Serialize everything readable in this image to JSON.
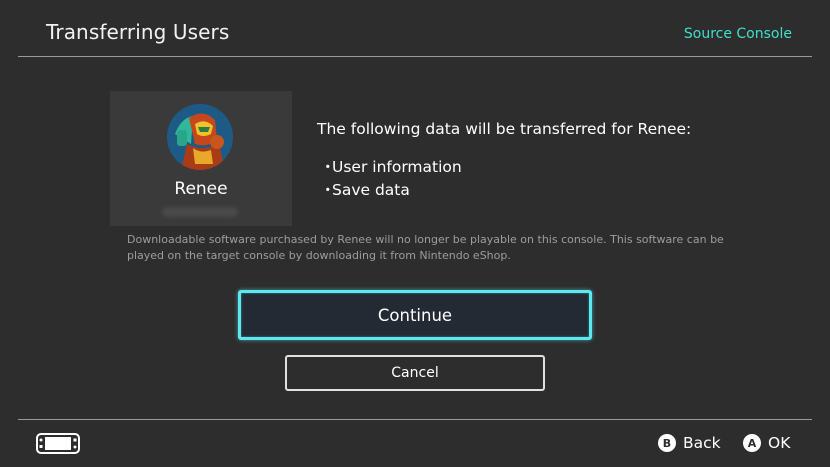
{
  "header": {
    "title": "Transferring Users",
    "right_label": "Source Console"
  },
  "user": {
    "name": "Renee",
    "avatar_icon": "character-avatar-icon"
  },
  "info": {
    "heading": "The following data will be transferred for Renee:",
    "items": [
      "User information",
      "Save data"
    ],
    "bullet": "・"
  },
  "notice": "Downloadable software purchased by Renee will no longer be playable on this console. This software can be played on the target console by downloading it from Nintendo eShop.",
  "buttons": {
    "continue_label": "Continue",
    "cancel_label": "Cancel"
  },
  "footer": {
    "console_icon": "handheld-console-icon",
    "back_key": "B",
    "back_label": "Back",
    "ok_key": "A",
    "ok_label": "OK"
  },
  "colors": {
    "background": "#2d2d2d",
    "accent": "#3ee0c8",
    "focus_border": "#5ee8f0"
  }
}
